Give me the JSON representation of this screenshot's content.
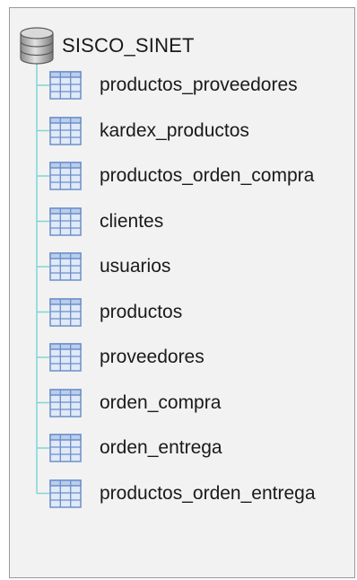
{
  "tree": {
    "root": {
      "label": "SISCO_SINET",
      "icon": "database-icon"
    },
    "items": [
      {
        "label": "productos_proveedores",
        "icon": "table-icon"
      },
      {
        "label": "kardex_productos",
        "icon": "table-icon"
      },
      {
        "label": "productos_orden_compra",
        "icon": "table-icon"
      },
      {
        "label": "clientes",
        "icon": "table-icon"
      },
      {
        "label": "usuarios",
        "icon": "table-icon"
      },
      {
        "label": "productos",
        "icon": "table-icon"
      },
      {
        "label": "proveedores",
        "icon": "table-icon"
      },
      {
        "label": "orden_compra",
        "icon": "table-icon"
      },
      {
        "label": "orden_entrega",
        "icon": "table-icon"
      },
      {
        "label": "productos_orden_entrega",
        "icon": "table-icon"
      }
    ]
  },
  "colors": {
    "connector": "#7fd6d2",
    "table_icon_border": "#6d8fc7",
    "table_icon_fill": "#dfe9f8"
  }
}
